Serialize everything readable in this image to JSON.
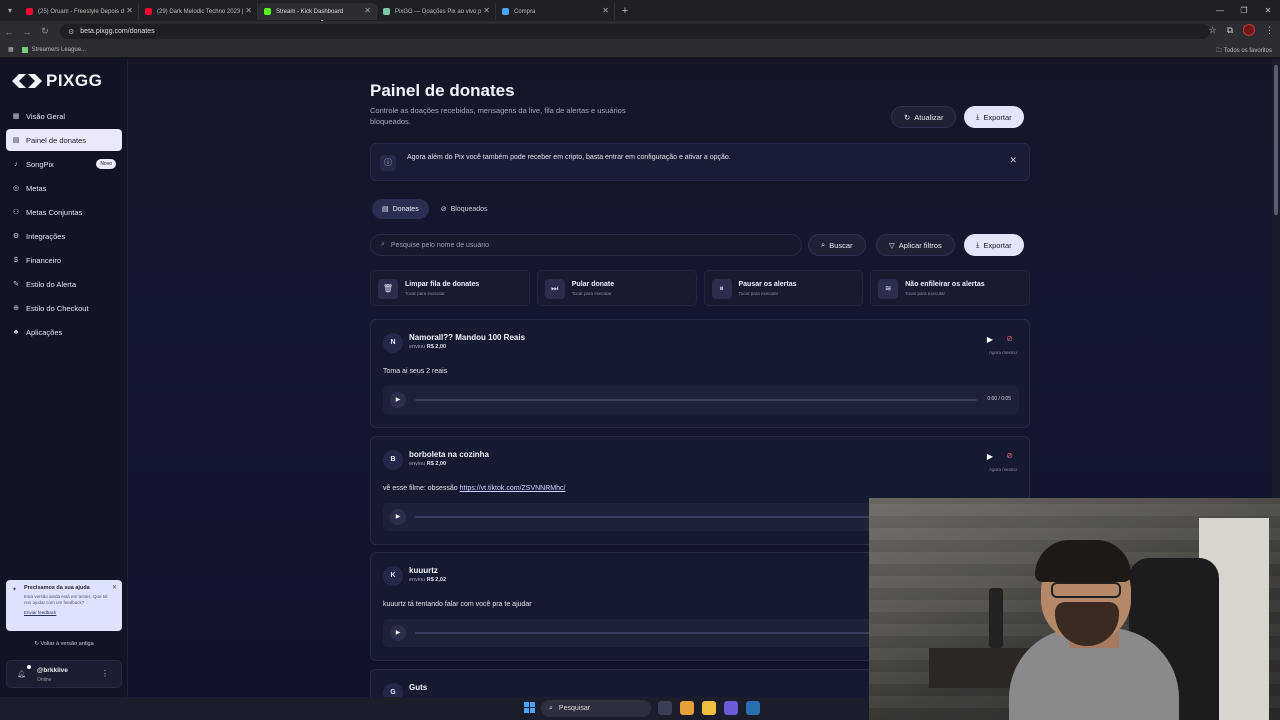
{
  "browser": {
    "tabs": [
      {
        "label": "(25) Oruam - Freestyle Depois d",
        "color": "#ff0033"
      },
      {
        "label": "(29) Dark Melodic Techno 2023 |",
        "color": "#ff0033"
      },
      {
        "label": "Stream - Kick Dashboard",
        "color": "#53fc18"
      },
      {
        "label": "PixGG — Doações Pix ao vivo p",
        "color": "#7bc8a4"
      },
      {
        "label": "Compra",
        "color": "#4aa3ff"
      }
    ],
    "url": "beta.pixgg.com/donates",
    "bookmark": "Streamers League...",
    "bookmarks_right": "Todos os favoritos"
  },
  "sidebar": {
    "brand": "PIXGG",
    "items": [
      {
        "label": "Visão Geral",
        "icon": "grid-icon"
      },
      {
        "label": "Painel de donates",
        "icon": "dashboard-icon"
      },
      {
        "label": "SongPix",
        "icon": "music-icon",
        "badge": "Novo"
      },
      {
        "label": "Metas",
        "icon": "target-icon"
      },
      {
        "label": "Metas Conjuntas",
        "icon": "group-target-icon"
      },
      {
        "label": "Integrações",
        "icon": "plug-icon"
      },
      {
        "label": "Financeiro",
        "icon": "money-icon"
      },
      {
        "label": "Estilo do Alerta",
        "icon": "brush-icon"
      },
      {
        "label": "Estilo do Checkout",
        "icon": "cart-icon"
      },
      {
        "label": "Aplicações",
        "icon": "apps-icon"
      }
    ],
    "help": {
      "title": "Precisamos da sua ajuda",
      "desc": "Esta versão ainda está em testes. Que tal nos ajudar com um feedback?",
      "link": "Enviar feedback"
    },
    "old_version": "Voltar à versão antiga",
    "user": {
      "name": "@brkklive",
      "status": "Online"
    }
  },
  "main": {
    "title": "Painel de donates",
    "subtitle": "Controle as doações recebidas, mensagens da live, fila de alertas e usuários bloqueados.",
    "btn_refresh": "Atualizar",
    "btn_export": "Exportar",
    "notice": "Agora além do Pix você também pode receber em cripto, basta entrar em configuração e ativar a opção.",
    "tabs": [
      "Donates",
      "Bloqueados"
    ],
    "search_placeholder": "Pesquise pelo nome de usuário",
    "btn_search": "Buscar",
    "btn_filters": "Aplicar filtros",
    "btn_export2": "Exportar",
    "actions": [
      {
        "title": "Limpar fila de donates",
        "sub": "Tocar para executar",
        "icon": "trash-icon"
      },
      {
        "title": "Pular donate",
        "sub": "Tocar para executar",
        "icon": "skip-icon"
      },
      {
        "title": "Pausar os alertas",
        "sub": "Tocar para executar",
        "icon": "pause-icon"
      },
      {
        "title": "Não enfileirar os alertas",
        "sub": "Tocar para executar",
        "icon": "layers-icon"
      }
    ],
    "donates": [
      {
        "initial": "N",
        "name": "Namorall?? Mandou 100 Reais",
        "sent": "enviou",
        "amount": "R$ 2,00",
        "time": "Agora mesmo",
        "message": "Toma ai seus 2 reais",
        "link": "",
        "duration": "0:00 / 0:05"
      },
      {
        "initial": "B",
        "name": "borboleta na cozinha",
        "sent": "enviou",
        "amount": "R$ 2,00",
        "time": "Agora mesmo",
        "message": "vê esse filme: obsessão",
        "link": "https://vt.tiktok.com/ZSVNNRMhc/",
        "duration": ""
      },
      {
        "initial": "K",
        "name": "kuuurtz",
        "sent": "enviou",
        "amount": "R$ 2,02",
        "time": "",
        "message": "kuuurtz tá tentando falar com você pra te ajudar",
        "link": "",
        "duration": ""
      },
      {
        "initial": "G",
        "name": "Guts",
        "sent": "",
        "amount": "",
        "time": "",
        "message": "",
        "link": "",
        "duration": ""
      }
    ]
  },
  "taskbar": {
    "search": "Pesquisar"
  }
}
